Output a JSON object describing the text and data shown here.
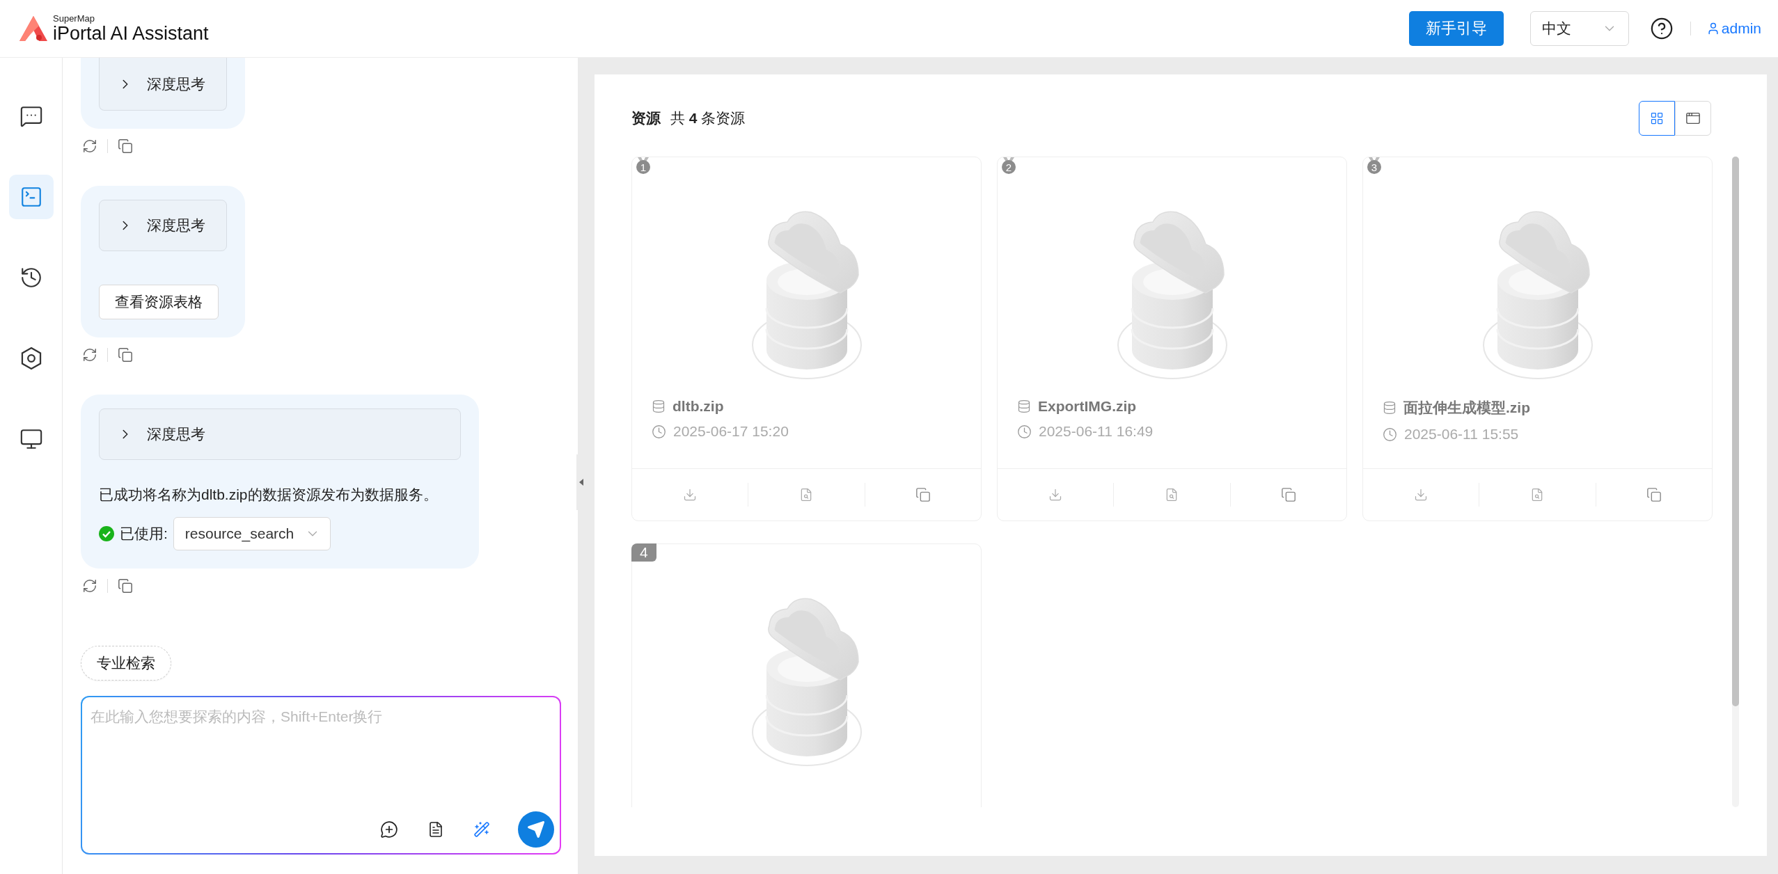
{
  "header": {
    "brand_small": "SuperMap",
    "brand": "iPortal AI Assistant",
    "guide_button": "新手引导",
    "language": "中文",
    "user": "admin"
  },
  "rail": [
    {
      "kind": "chats",
      "selected": false
    },
    {
      "kind": "terminal",
      "selected": true
    },
    {
      "kind": "history",
      "selected": false
    },
    {
      "kind": "hexagon",
      "selected": false
    },
    {
      "kind": "monitor",
      "selected": false
    }
  ],
  "messages": [
    {
      "think": "深度思考",
      "wide": false
    },
    {
      "think": "深度思考",
      "wide": false,
      "button": "查看资源表格"
    },
    {
      "think": "深度思考",
      "wide": true,
      "text": "已成功将名称为dltb.zip的数据资源发布为数据服务。",
      "tool_label": "已使用:",
      "tool": "resource_search"
    }
  ],
  "quick_tag": "专业检索",
  "input": {
    "placeholder": "在此输入您想要探索的内容，Shift+Enter换行"
  },
  "resources": {
    "title": "资源",
    "count": "共 **4** 条资源",
    "view_modes": [
      {
        "kind": "grid",
        "selected": true
      },
      {
        "kind": "table",
        "selected": false
      }
    ],
    "items": [
      {
        "rank": "1",
        "kind": "medal",
        "name": "dltb.zip",
        "time": "2025-06-17 15:20"
      },
      {
        "rank": "2",
        "kind": "medal",
        "name": "ExportIMG.zip",
        "time": "2025-06-11 16:49"
      },
      {
        "rank": "3",
        "kind": "medal",
        "name": "面拉伸生成模型.zip",
        "time": "2025-06-11 15:55"
      },
      {
        "rank": "4",
        "kind": "tag"
      }
    ]
  }
}
